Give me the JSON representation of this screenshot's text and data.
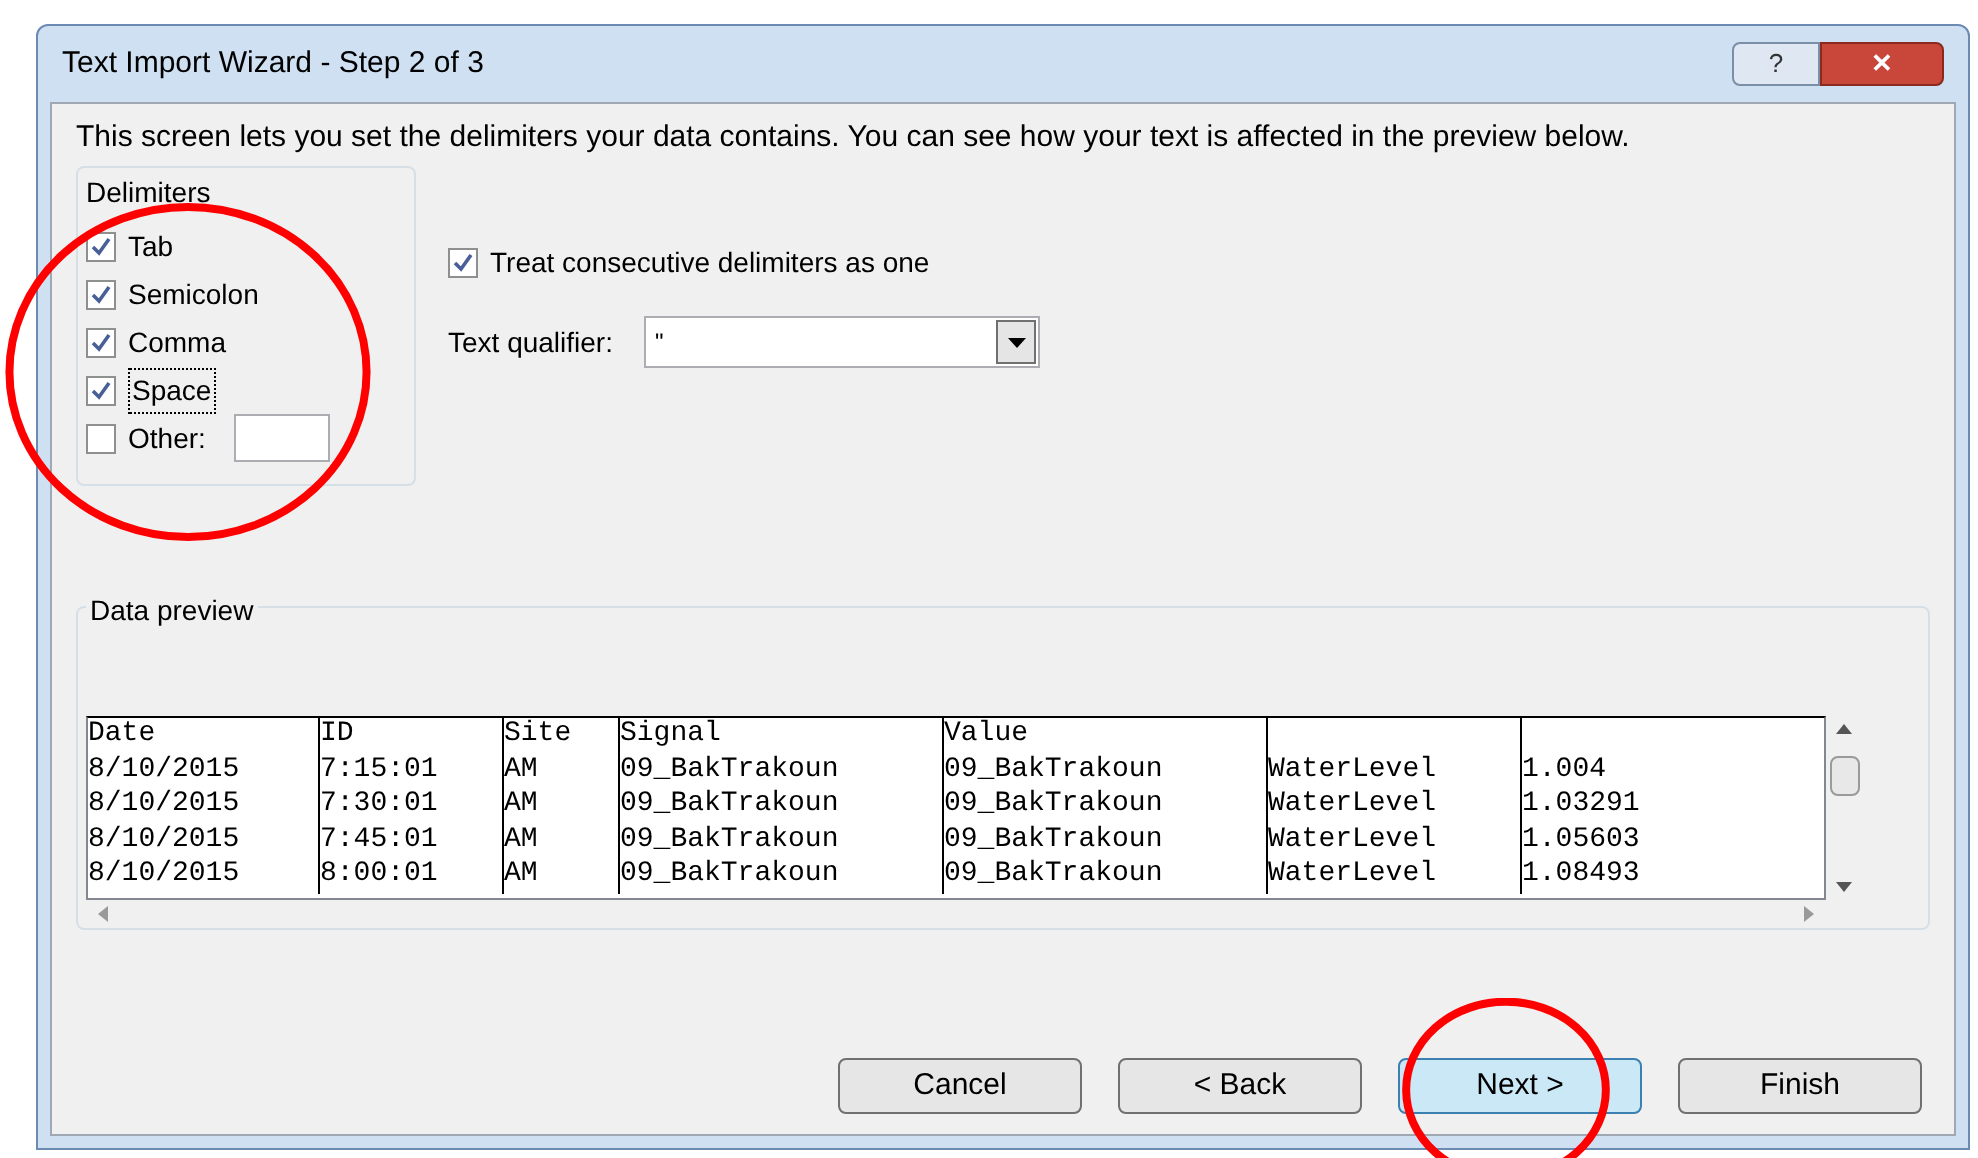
{
  "window": {
    "title": "Text Import Wizard - Step 2 of 3",
    "help": "?",
    "close": "✕"
  },
  "intro": "This screen lets you set the delimiters your data contains.  You can see how your text is affected in the preview below.",
  "delimiters": {
    "title": "Delimiters",
    "highlighted": true,
    "items": [
      {
        "label": "Tab",
        "checked": true,
        "focused": false
      },
      {
        "label": "Semicolon",
        "checked": true,
        "focused": false
      },
      {
        "label": "Comma",
        "checked": true,
        "focused": false
      },
      {
        "label": "Space",
        "checked": true,
        "focused": true
      },
      {
        "label": "Other:",
        "checked": false,
        "focused": false,
        "kind": "other"
      }
    ]
  },
  "consecutive": {
    "label": "Treat consecutive delimiters as one",
    "checked": true
  },
  "qualifier": {
    "label": "Text qualifier:",
    "value": "\""
  },
  "preview": {
    "title": "Data preview",
    "rows": [
      [
        "Date",
        "ID",
        "Site",
        "Signal",
        "Value",
        "",
        ""
      ],
      [
        "8/10/2015",
        "7:15:01",
        "AM",
        "09_BakTrakoun",
        "09_BakTrakoun",
        "WaterLevel",
        "1.004"
      ],
      [
        "8/10/2015",
        "7:30:01",
        "AM",
        "09_BakTrakoun",
        "09_BakTrakoun",
        "WaterLevel",
        "1.03291"
      ],
      [
        "8/10/2015",
        "7:45:01",
        "AM",
        "09_BakTrakoun",
        "09_BakTrakoun",
        "WaterLevel",
        "1.05603"
      ],
      [
        "8/10/2015",
        "8:00:01",
        "AM",
        "09_BakTrakoun",
        "09_BakTrakoun",
        "WaterLevel",
        "1.08493"
      ]
    ]
  },
  "buttons": [
    {
      "label": "Cancel",
      "default": false,
      "highlighted": false
    },
    {
      "label": "< Back",
      "default": false,
      "highlighted": false
    },
    {
      "label": "Next >",
      "default": true,
      "highlighted": true
    },
    {
      "label": "Finish",
      "default": false,
      "highlighted": false
    }
  ]
}
